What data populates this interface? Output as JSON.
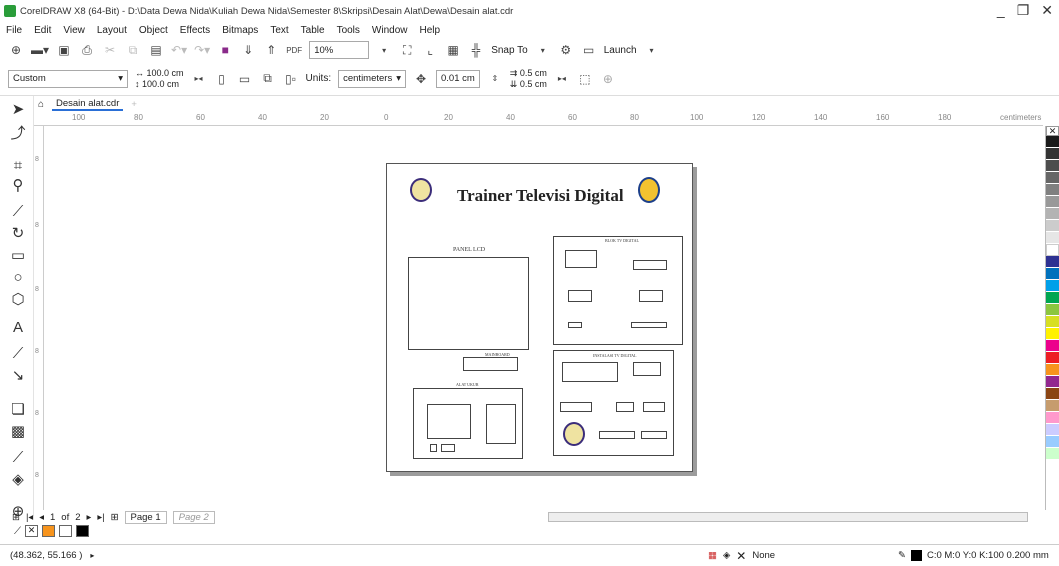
{
  "window": {
    "title": "CorelDRAW X8 (64-Bit) - D:\\Data Dewa Nida\\Kuliah Dewa Nida\\Semester 8\\Skripsi\\Desain Alat\\Dewa\\Desain alat.cdr"
  },
  "menu": [
    "File",
    "Edit",
    "View",
    "Layout",
    "Object",
    "Effects",
    "Bitmaps",
    "Text",
    "Table",
    "Tools",
    "Window",
    "Help"
  ],
  "toolbar": {
    "zoom": "10%",
    "snap_to": "Snap To",
    "launch": "Launch"
  },
  "property_bar": {
    "page_preset": "Custom",
    "width": "100.0 cm",
    "height": "100.0 cm",
    "units_label": "Units:",
    "units": "centimeters",
    "nudge": "0.01 cm",
    "dup_x": "0.5 cm",
    "dup_y": "0.5 cm"
  },
  "document_tab": "Desain alat.cdr",
  "ruler": {
    "h_ticks": [
      "100",
      "80",
      "60",
      "40",
      "20",
      "0",
      "20",
      "40",
      "60",
      "80",
      "100",
      "120",
      "140",
      "160",
      "180"
    ],
    "unit": "centimeters",
    "v_ticks": [
      "8",
      "8",
      "8",
      "8",
      "8",
      "8",
      "8",
      "8"
    ]
  },
  "design": {
    "title": "Trainer Televisi Digital",
    "panel_lcd": "PANEL LCD",
    "block_tv": "BLOK TV DIGITAL",
    "instalasi": "INSTALASI TV DIGITAL",
    "alat_ukur": "ALAT UKUR",
    "mainboard": "MAINBOARD"
  },
  "page_nav": {
    "current": "1",
    "of_label": "of",
    "total": "2",
    "tabs": [
      "Page 1",
      "Page 2"
    ]
  },
  "status": {
    "coords": "(48.362, 55.166 )",
    "fill": "None",
    "outline": "C:0 M:0 Y:0 K:100 0.200 mm"
  },
  "colors": {
    "palette": [
      "#ffffff",
      "#000000",
      "#1a1a1a",
      "#333333",
      "#4d4d4d",
      "#666666",
      "#808080",
      "#999999",
      "#b3b3b3",
      "#cccccc",
      "#e6e6e6",
      "#ffffff",
      "#2e3192",
      "#0071bc",
      "#00a0e9",
      "#00a651",
      "#8cc63f",
      "#d7df23",
      "#fff200",
      "#f7941d",
      "#ed1c24",
      "#ec008c",
      "#92278f",
      "#8b4513",
      "#c69c6d",
      "#a67c52",
      "#ff99cc",
      "#ccccff",
      "#99ccff",
      "#ccffcc"
    ],
    "accent": "#f7941d"
  }
}
